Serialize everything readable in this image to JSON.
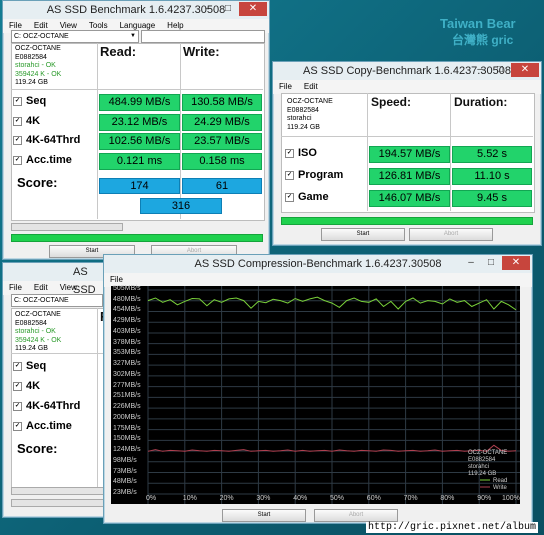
{
  "watermark": {
    "line1": "Taiwan Bear",
    "line2": "台灣熊 gric"
  },
  "bench": {
    "title": "AS SSD Benchmark 1.6.4237.30508",
    "menu": [
      "File",
      "Edit",
      "View",
      "Tools",
      "Language",
      "Help"
    ],
    "drive": "C: OCZ-OCTANE",
    "info": [
      "OCZ-OCTANE",
      "E0882584",
      "storahci - OK",
      "359424 K - OK",
      "119.24 GB"
    ],
    "read_header": "Read:",
    "write_header": "Write:",
    "rows": [
      {
        "label": "Seq",
        "read": "484.99 MB/s",
        "write": "130.58 MB/s"
      },
      {
        "label": "4K",
        "read": "23.12 MB/s",
        "write": "24.29 MB/s"
      },
      {
        "label": "4K-64Thrd",
        "read": "102.56 MB/s",
        "write": "23.57 MB/s"
      },
      {
        "label": "Acc.time",
        "read": "0.121 ms",
        "write": "0.158 ms"
      }
    ],
    "score_label": "Score:",
    "score_read": "174",
    "score_write": "61",
    "score_total": "316",
    "start": "Start",
    "abort": "Abort",
    "progress": 1.0
  },
  "copy": {
    "title": "AS SSD Copy-Benchmark 1.6.4237.30508",
    "menu": [
      "File",
      "Edit"
    ],
    "info": [
      "OCZ-OCTANE",
      "E0882584",
      "storahci",
      "119.24 GB"
    ],
    "speed_header": "Speed:",
    "duration_header": "Duration:",
    "rows": [
      {
        "label": "ISO",
        "speed": "194.57 MB/s",
        "duration": "5.52 s"
      },
      {
        "label": "Program",
        "speed": "126.81 MB/s",
        "duration": "11.10 s"
      },
      {
        "label": "Game",
        "speed": "146.07 MB/s",
        "duration": "9.45 s"
      }
    ],
    "start": "Start",
    "abort": "Abort",
    "progress": 1.0
  },
  "bench2": {
    "title": "AS SSD",
    "menu": [
      "File",
      "Edit",
      "View"
    ],
    "drive": "C: OCZ-OCTANE",
    "info": [
      "OCZ-OCTANE",
      "E0882584",
      "storahci - OK",
      "359424 K - OK",
      "119.24 GB"
    ],
    "rows": [
      "Seq",
      "4K",
      "4K-64Thrd",
      "Acc.time"
    ],
    "score_label": "Score:",
    "col_partial": "R"
  },
  "comp": {
    "title": "AS SSD Compression-Benchmark 1.6.4237.30508",
    "menu": [
      "File"
    ],
    "y_labels": [
      "505MB/s",
      "480MB/s",
      "454MB/s",
      "429MB/s",
      "403MB/s",
      "378MB/s",
      "353MB/s",
      "327MB/s",
      "302MB/s",
      "277MB/s",
      "251MB/s",
      "226MB/s",
      "200MB/s",
      "175MB/s",
      "150MB/s",
      "124MB/s",
      "98MB/s",
      "73MB/s",
      "48MB/s",
      "23MB/s"
    ],
    "x_labels": [
      "0%",
      "10%",
      "20%",
      "30%",
      "40%",
      "50%",
      "60%",
      "70%",
      "80%",
      "90%",
      "100%"
    ],
    "legend_info": [
      "OCZ-OCTANE",
      "E0882584",
      "storahci",
      "119.24 GB"
    ],
    "legend_read": "Read",
    "legend_write": "Write",
    "read_color": "#7ad13a",
    "write_color": "#b04050",
    "start": "Start",
    "abort": "Abort"
  },
  "url": "http://gric.pixnet.net/album",
  "chart_data": {
    "type": "line",
    "x": [
      0,
      2,
      4,
      6,
      8,
      10,
      12,
      14,
      16,
      18,
      20,
      22,
      24,
      26,
      28,
      30,
      32,
      34,
      36,
      38,
      40,
      42,
      44,
      46,
      48,
      50,
      52,
      54,
      56,
      58,
      60,
      62,
      64,
      66,
      68,
      70,
      72,
      74,
      76,
      78,
      80,
      82,
      84,
      86,
      88,
      90,
      92,
      94,
      96,
      98,
      100
    ],
    "series": [
      {
        "name": "Read",
        "values": [
          480,
          486,
          476,
          482,
          470,
          478,
          485,
          484,
          468,
          482,
          476,
          484,
          486,
          480,
          462,
          478,
          475,
          483,
          480,
          474,
          485,
          478,
          484,
          488,
          480,
          474,
          464,
          480,
          486,
          478,
          476,
          484,
          466,
          478,
          460,
          478,
          486,
          474,
          480,
          478,
          472,
          484,
          476,
          480,
          466,
          474,
          482,
          460,
          478,
          470,
          458
        ]
      },
      {
        "name": "Write",
        "values": [
          124,
          128,
          124,
          126,
          125,
          124,
          127,
          125,
          124,
          126,
          125,
          124,
          126,
          128,
          124,
          125,
          126,
          124,
          125,
          127,
          124,
          126,
          124,
          125,
          126,
          124,
          127,
          125,
          124,
          126,
          125,
          124,
          127,
          126,
          124,
          125,
          126,
          124,
          125,
          127,
          124,
          125,
          126,
          124,
          125,
          126,
          124,
          138,
          126,
          124,
          125
        ]
      }
    ],
    "xlabel": "",
    "ylabel": "",
    "ylim": [
      0,
      505
    ]
  }
}
